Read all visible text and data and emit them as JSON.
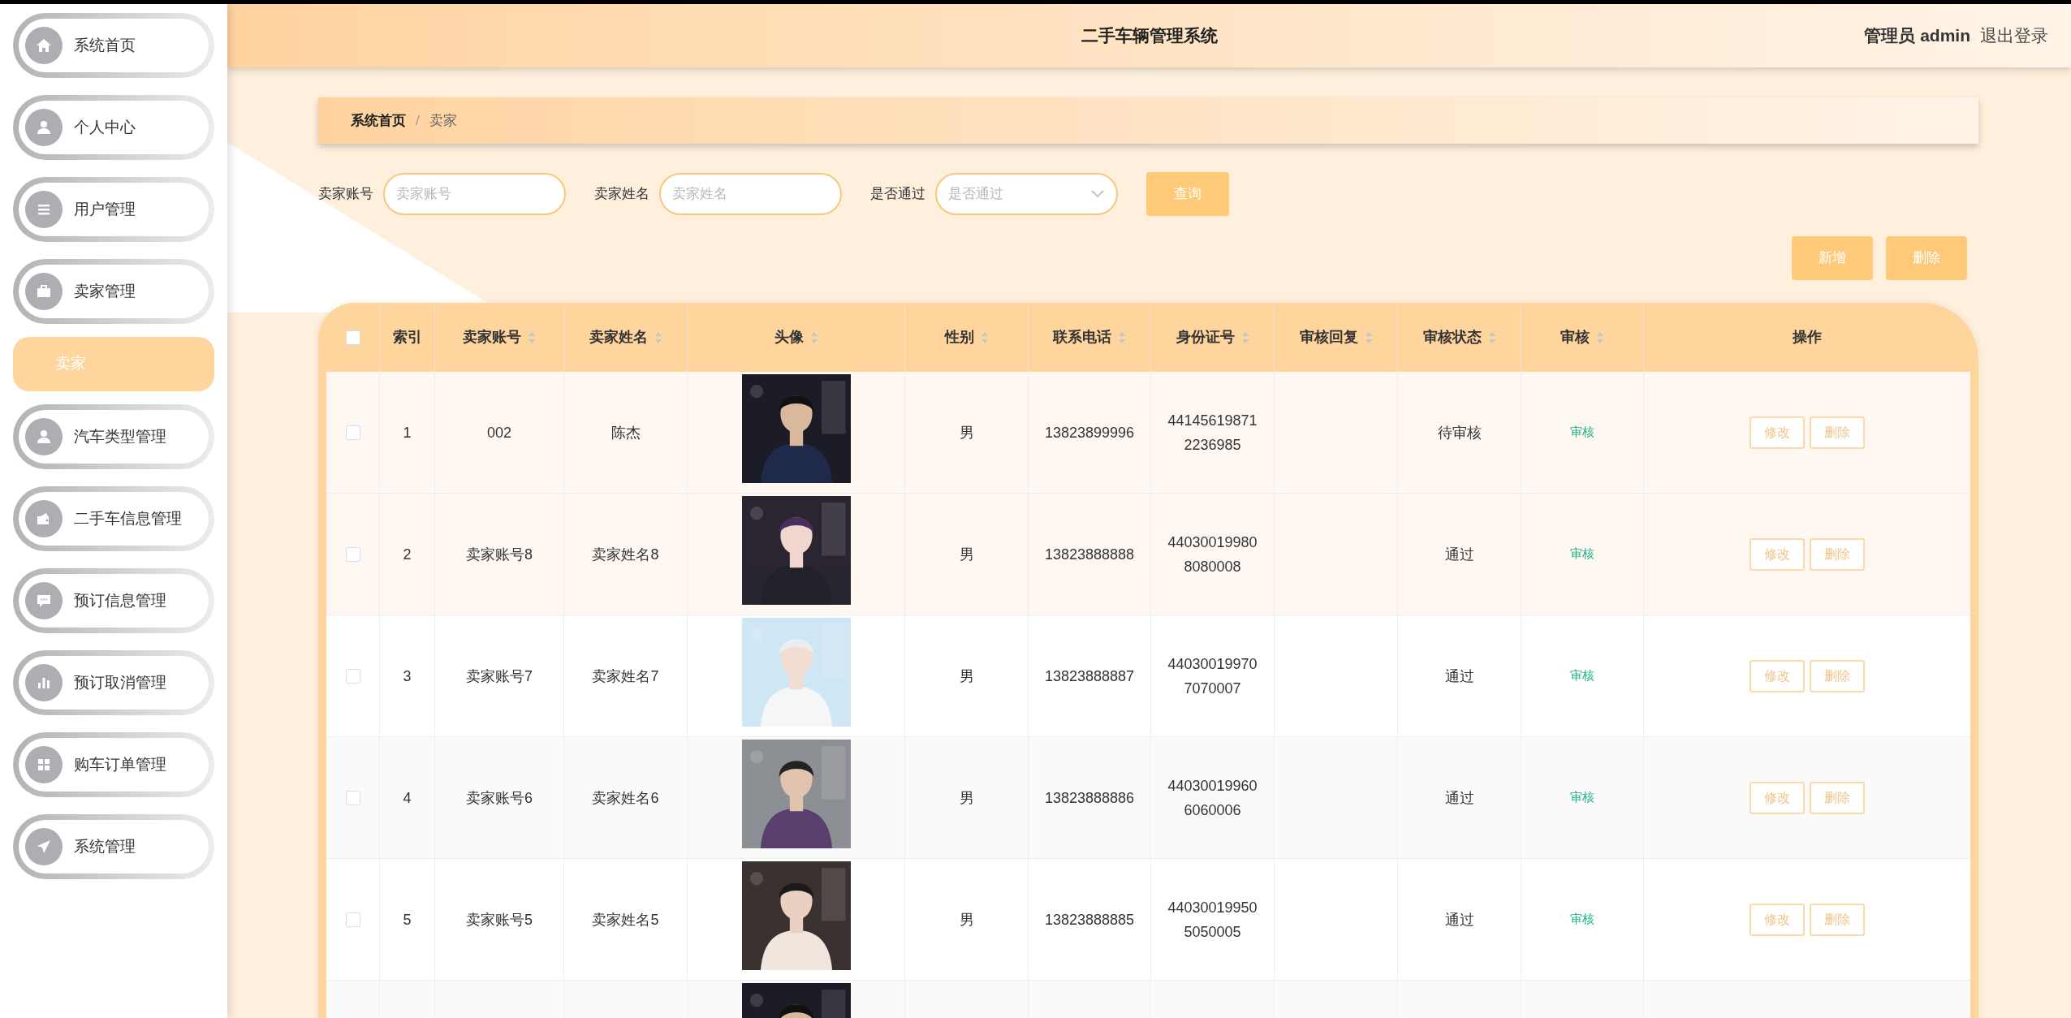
{
  "header": {
    "title": "二手车辆管理系统",
    "user_role": "管理员",
    "user_name": "admin",
    "logout": "退出登录"
  },
  "sidebar": {
    "items": [
      {
        "label": "系统首页"
      },
      {
        "label": "个人中心"
      },
      {
        "label": "用户管理"
      },
      {
        "label": "卖家管理",
        "children": [
          {
            "label": "卖家",
            "selected": true
          }
        ]
      },
      {
        "label": "汽车类型管理"
      },
      {
        "label": "二手车信息管理"
      },
      {
        "label": "预订信息管理"
      },
      {
        "label": "预订取消管理"
      },
      {
        "label": "购车订单管理"
      },
      {
        "label": "系统管理"
      }
    ]
  },
  "breadcrumb": {
    "items": [
      "系统首页",
      "卖家"
    ],
    "separator": "/"
  },
  "filters": [
    {
      "kind": "input",
      "label": "卖家账号",
      "placeholder": "卖家账号"
    },
    {
      "kind": "input",
      "label": "卖家姓名",
      "placeholder": "卖家姓名"
    },
    {
      "kind": "select",
      "label": "是否通过",
      "placeholder": "是否通过"
    }
  ],
  "search_button": "查询",
  "actions": [
    "新增",
    "删除"
  ],
  "table": {
    "all_selected": false,
    "columns": [
      {
        "label": "索引",
        "sortable": false
      },
      {
        "label": "卖家账号",
        "sortable": true
      },
      {
        "label": "卖家姓名",
        "sortable": true
      },
      {
        "label": "头像",
        "sortable": true
      },
      {
        "label": "性别",
        "sortable": true
      },
      {
        "label": "联系电话",
        "sortable": true
      },
      {
        "label": "身份证号",
        "sortable": true
      },
      {
        "label": "审核回复",
        "sortable": true
      },
      {
        "label": "审核状态",
        "sortable": true
      },
      {
        "label": "审核",
        "sortable": true
      },
      {
        "label": "操作",
        "sortable": false
      }
    ],
    "rows": [
      {
        "selected": false,
        "index": "1",
        "account": "002",
        "name": "陈杰",
        "gender": "男",
        "phone": "13823899996",
        "id_number": "441456198712236985",
        "review_status": "待审核",
        "review_link": "审核",
        "edit": "修改",
        "delete": "删除"
      },
      {
        "selected": false,
        "index": "2",
        "account": "卖家账号8",
        "name": "卖家姓名8",
        "gender": "男",
        "phone": "13823888888",
        "id_number": "440300199808080008",
        "review_status": "通过",
        "review_link": "审核",
        "edit": "修改",
        "delete": "删除"
      },
      {
        "selected": false,
        "index": "3",
        "account": "卖家账号7",
        "name": "卖家姓名7",
        "gender": "男",
        "phone": "13823888887",
        "id_number": "440300199707070007",
        "review_status": "通过",
        "review_link": "审核",
        "edit": "修改",
        "delete": "删除"
      },
      {
        "selected": false,
        "index": "4",
        "account": "卖家账号6",
        "name": "卖家姓名6",
        "gender": "男",
        "phone": "13823888886",
        "id_number": "440300199606060006",
        "review_status": "通过",
        "review_link": "审核",
        "edit": "修改",
        "delete": "删除"
      },
      {
        "selected": false,
        "index": "5",
        "account": "卖家账号5",
        "name": "卖家姓名5",
        "gender": "男",
        "phone": "13823888885",
        "id_number": "440300199505050005",
        "review_status": "通过",
        "review_link": "审核",
        "edit": "修改",
        "delete": "删除"
      }
    ]
  }
}
